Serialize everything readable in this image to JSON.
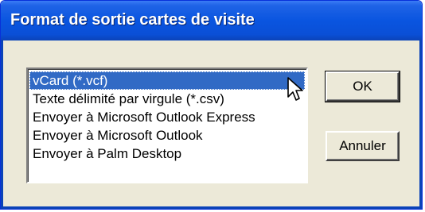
{
  "window": {
    "title": "Format de sortie cartes de visite"
  },
  "list": {
    "items": [
      "vCard (*.vcf)",
      "Texte délimité par virgule (*.csv)",
      "Envoyer à Microsoft Outlook Express",
      "Envoyer à Microsoft Outlook",
      "Envoyer à Palm Desktop"
    ],
    "selected": "vCard (*.vcf)"
  },
  "buttons": {
    "ok_label": "OK",
    "cancel_label": "Annuler"
  },
  "colors": {
    "titlebar": "#0a55e0",
    "selection": "#316ac5",
    "dialog_bg": "#ece9d8"
  },
  "icons": {
    "pointer": "arrow-cursor-icon"
  }
}
